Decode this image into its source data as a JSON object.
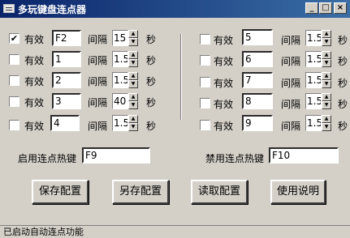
{
  "window": {
    "title": "多玩键盘连点器",
    "min": "_",
    "max": "□",
    "close": "×"
  },
  "labels": {
    "valid": "有效",
    "interval": "间隔",
    "seconds": "秒"
  },
  "left_rows": [
    {
      "checked": "✔",
      "key": "F2",
      "interval": "15"
    },
    {
      "checked": "",
      "key": "1",
      "interval": "1.5"
    },
    {
      "checked": "",
      "key": "2",
      "interval": "1.5"
    },
    {
      "checked": "",
      "key": "3",
      "interval": "40"
    },
    {
      "checked": "",
      "key": "4",
      "interval": "1.5"
    }
  ],
  "right_rows": [
    {
      "checked": "",
      "key": "5",
      "interval": "1.5"
    },
    {
      "checked": "",
      "key": "6",
      "interval": "1.5"
    },
    {
      "checked": "",
      "key": "7",
      "interval": "1.5"
    },
    {
      "checked": "",
      "key": "8",
      "interval": "1.5"
    },
    {
      "checked": "",
      "key": "9",
      "interval": "1.5"
    }
  ],
  "hotkeys": {
    "enable_label": "启用连点热键",
    "enable_value": "F9",
    "disable_label": "禁用连点热键",
    "disable_value": "F10"
  },
  "buttons": {
    "save": "保存配置",
    "save_as": "另存配置",
    "load": "读取配置",
    "help": "使用说明"
  },
  "status": "已启动自动连点功能",
  "spin_up": "▲",
  "spin_down": "▼"
}
